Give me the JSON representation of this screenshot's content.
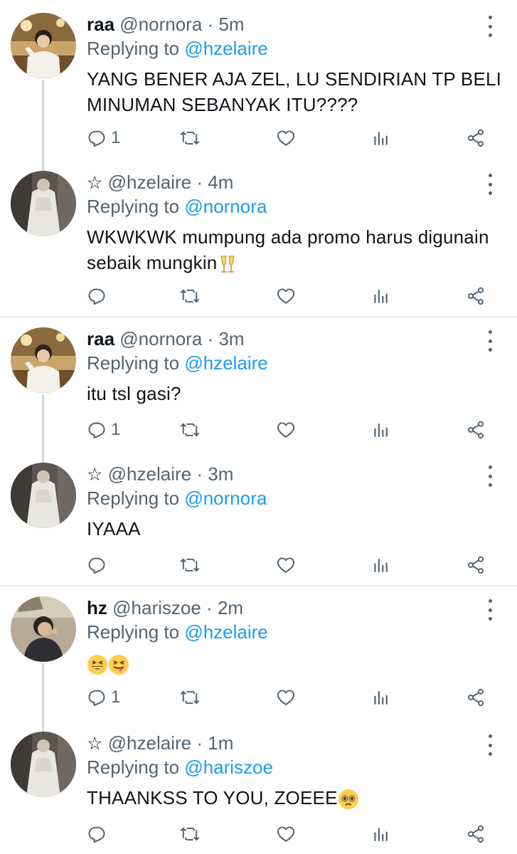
{
  "tweets": [
    {
      "name": "raa",
      "handle": "@nornora",
      "sep": "·",
      "time": "5m",
      "replying_prefix": "Replying to",
      "replying_to": "@hzelaire",
      "text": "YANG BENER AJA ZEL, LU SENDIRIAN TP BELI MINUMAN SEBANYAK ITU????",
      "reply_count": "1"
    },
    {
      "name": "☆",
      "handle": "@hzelaire",
      "sep": "·",
      "time": "4m",
      "replying_prefix": "Replying to",
      "replying_to": "@nornora",
      "text": "WKWKWK mumpung ada promo harus digunain sebaik mungkin",
      "emoji": "clinking-glasses",
      "reply_count": ""
    },
    {
      "name": "raa",
      "handle": "@nornora",
      "sep": "·",
      "time": "3m",
      "replying_prefix": "Replying to",
      "replying_to": "@hzelaire",
      "text": "itu tsl gasi?",
      "reply_count": "1"
    },
    {
      "name": "☆",
      "handle": "@hzelaire",
      "sep": "·",
      "time": "3m",
      "replying_prefix": "Replying to",
      "replying_to": "@nornora",
      "text": "IYAAA",
      "reply_count": ""
    },
    {
      "name": "hz",
      "handle": "@hariszoe",
      "sep": "·",
      "time": "2m",
      "replying_prefix": "Replying to",
      "replying_to": "@hzelaire",
      "text": "",
      "emoji": "grinning-squinting, squinting-tongue",
      "reply_count": "1"
    },
    {
      "name": "☆",
      "handle": "@hzelaire",
      "sep": "·",
      "time": "1m",
      "replying_prefix": "Replying to",
      "replying_to": "@hariszoe",
      "text": "THAANKSS TO YOU, ZOEEE",
      "emoji": "pleading-face",
      "reply_count": ""
    }
  ],
  "icons": {
    "reply": "reply-icon",
    "retweet": "retweet-icon",
    "like": "heart-icon",
    "views": "analytics-icon",
    "share": "share-icon",
    "more": "more-icon"
  },
  "colors": {
    "mention": "#1d9bf0",
    "muted": "#536471",
    "thread_line": "#cfd9de",
    "divider": "#e6ecf0"
  }
}
